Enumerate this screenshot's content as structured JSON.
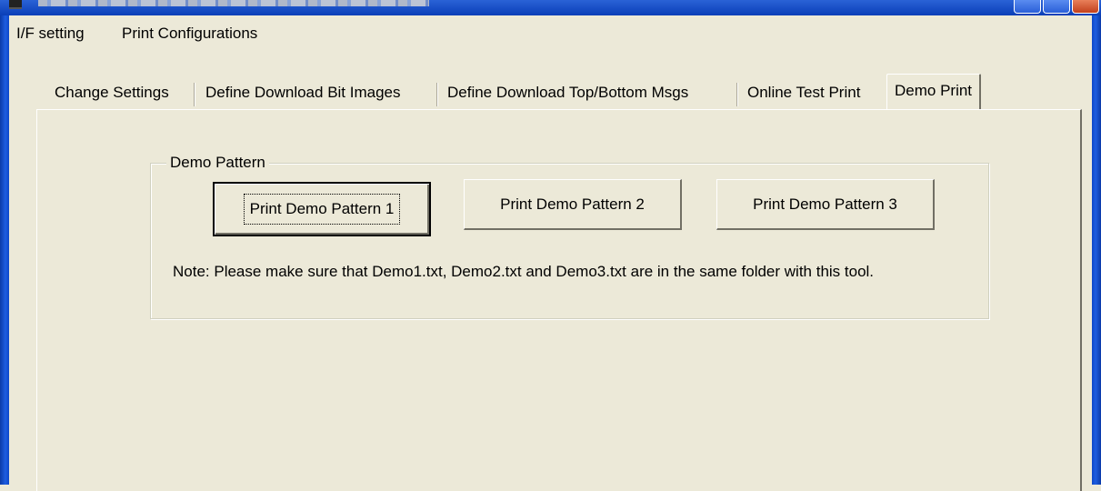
{
  "window": {
    "title_bar_colors": {
      "active": "#0a3fb8",
      "close": "#c2401c"
    }
  },
  "menubar": {
    "items": [
      {
        "label": "I/F setting"
      },
      {
        "label": "Print Configurations"
      }
    ]
  },
  "tabs": [
    {
      "label": "Change Settings",
      "active": false
    },
    {
      "label": "Define Download Bit Images",
      "active": false
    },
    {
      "label": "Define Download Top/Bottom Msgs",
      "active": false
    },
    {
      "label": "Online Test Print",
      "active": false
    },
    {
      "label": "Demo Print",
      "active": true
    }
  ],
  "demo_pattern": {
    "group_label": "Demo Pattern",
    "buttons": [
      {
        "label": "Print Demo Pattern 1",
        "focused": true
      },
      {
        "label": "Print Demo Pattern 2",
        "focused": false
      },
      {
        "label": "Print Demo Pattern 3",
        "focused": false
      }
    ],
    "note": "Note: Please make sure that Demo1.txt, Demo2.txt and Demo3.txt are in the same folder with this tool."
  }
}
